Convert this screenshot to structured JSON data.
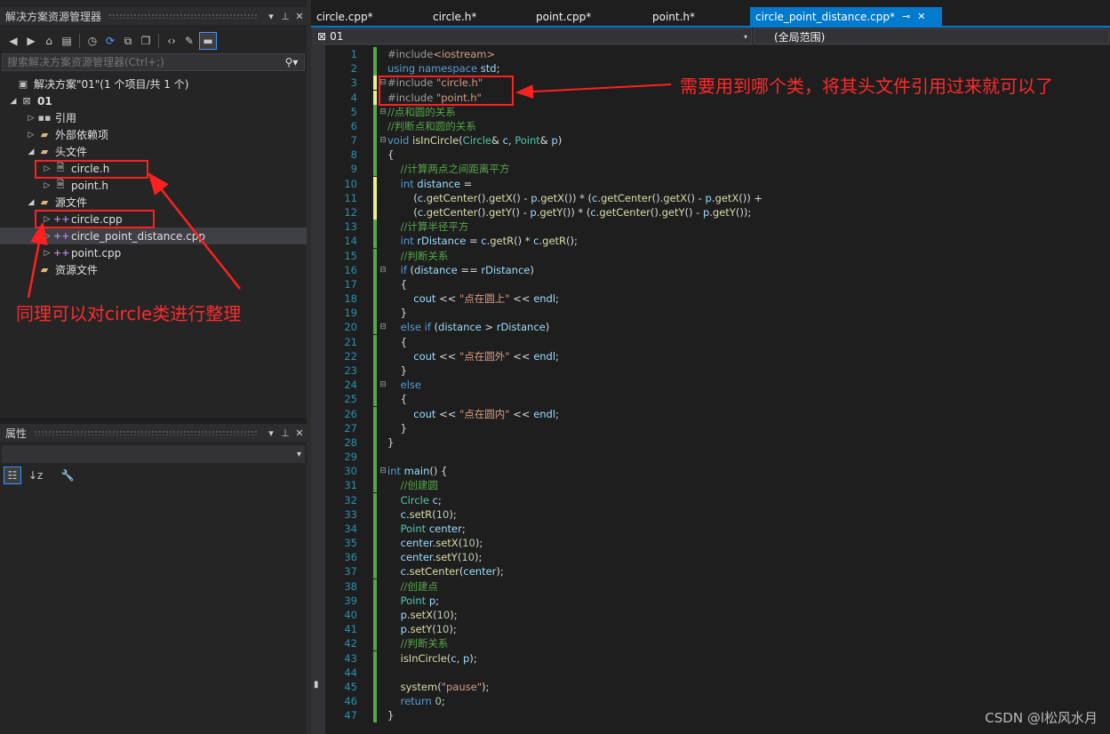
{
  "solution_explorer": {
    "title": "解决方案资源管理器",
    "search_placeholder": "搜索解决方案资源管理器(Ctrl+;)",
    "tree": {
      "solution": "解决方案\"01\"(1 个项目/共 1 个)",
      "project": "01",
      "references": "引用",
      "external_deps": "外部依赖项",
      "header_folder": "头文件",
      "headers": [
        "circle.h",
        "point.h"
      ],
      "source_folder": "源文件",
      "sources": [
        "circle.cpp",
        "circle_point_distance.cpp",
        "point.cpp"
      ],
      "resource_folder": "资源文件"
    }
  },
  "properties": {
    "title": "属性"
  },
  "editor": {
    "tabs": [
      {
        "label": "circle.cpp*",
        "active": false
      },
      {
        "label": "circle.h*",
        "active": false
      },
      {
        "label": "point.cpp*",
        "active": false
      },
      {
        "label": "point.h*",
        "active": false
      },
      {
        "label": "circle_point_distance.cpp*",
        "active": true
      }
    ],
    "nav_project": "01",
    "nav_scope": "(全局范围)",
    "code_lines": [
      "#include<iostream>",
      "using namespace std;",
      "#include \"circle.h\"",
      "#include \"point.h\"",
      "//点和圆的关系",
      "//判断点和圆的关系",
      "void isInCircle(Circle& c, Point& p)",
      "{",
      "    //计算两点之间距离平方",
      "    int distance =",
      "        (c.getCenter().getX() - p.getX()) * (c.getCenter().getX() - p.getX()) +",
      "        (c.getCenter().getY() - p.getY()) * (c.getCenter().getY() - p.getY());",
      "    //计算半径平方",
      "    int rDistance = c.getR() * c.getR();",
      "    //判断关系",
      "    if (distance == rDistance)",
      "    {",
      "        cout << \"点在圆上\" << endl;",
      "    }",
      "    else if (distance > rDistance)",
      "    {",
      "        cout << \"点在圆外\" << endl;",
      "    }",
      "    else",
      "    {",
      "        cout << \"点在圆内\" << endl;",
      "    }",
      "}",
      "",
      "int main() {",
      "    //创建圆",
      "    Circle c;",
      "    c.setR(10);",
      "    Point center;",
      "    center.setX(10);",
      "    center.setY(10);",
      "    c.setCenter(center);",
      "    //创建点",
      "    Point p;",
      "    p.setX(10);",
      "    p.setY(10);",
      "    //判断关系",
      "    isInCircle(c, p);",
      "",
      "    system(\"pause\");",
      "    return 0;",
      "}"
    ]
  },
  "annotations": {
    "right": "需要用到哪个类，将其头文件引用过来就可以了",
    "left": "同理可以对circle类进行整理"
  },
  "watermark": "CSDN @l松风水月",
  "colors": {
    "accent": "#007acc",
    "annotation_red": "#ff2020"
  }
}
